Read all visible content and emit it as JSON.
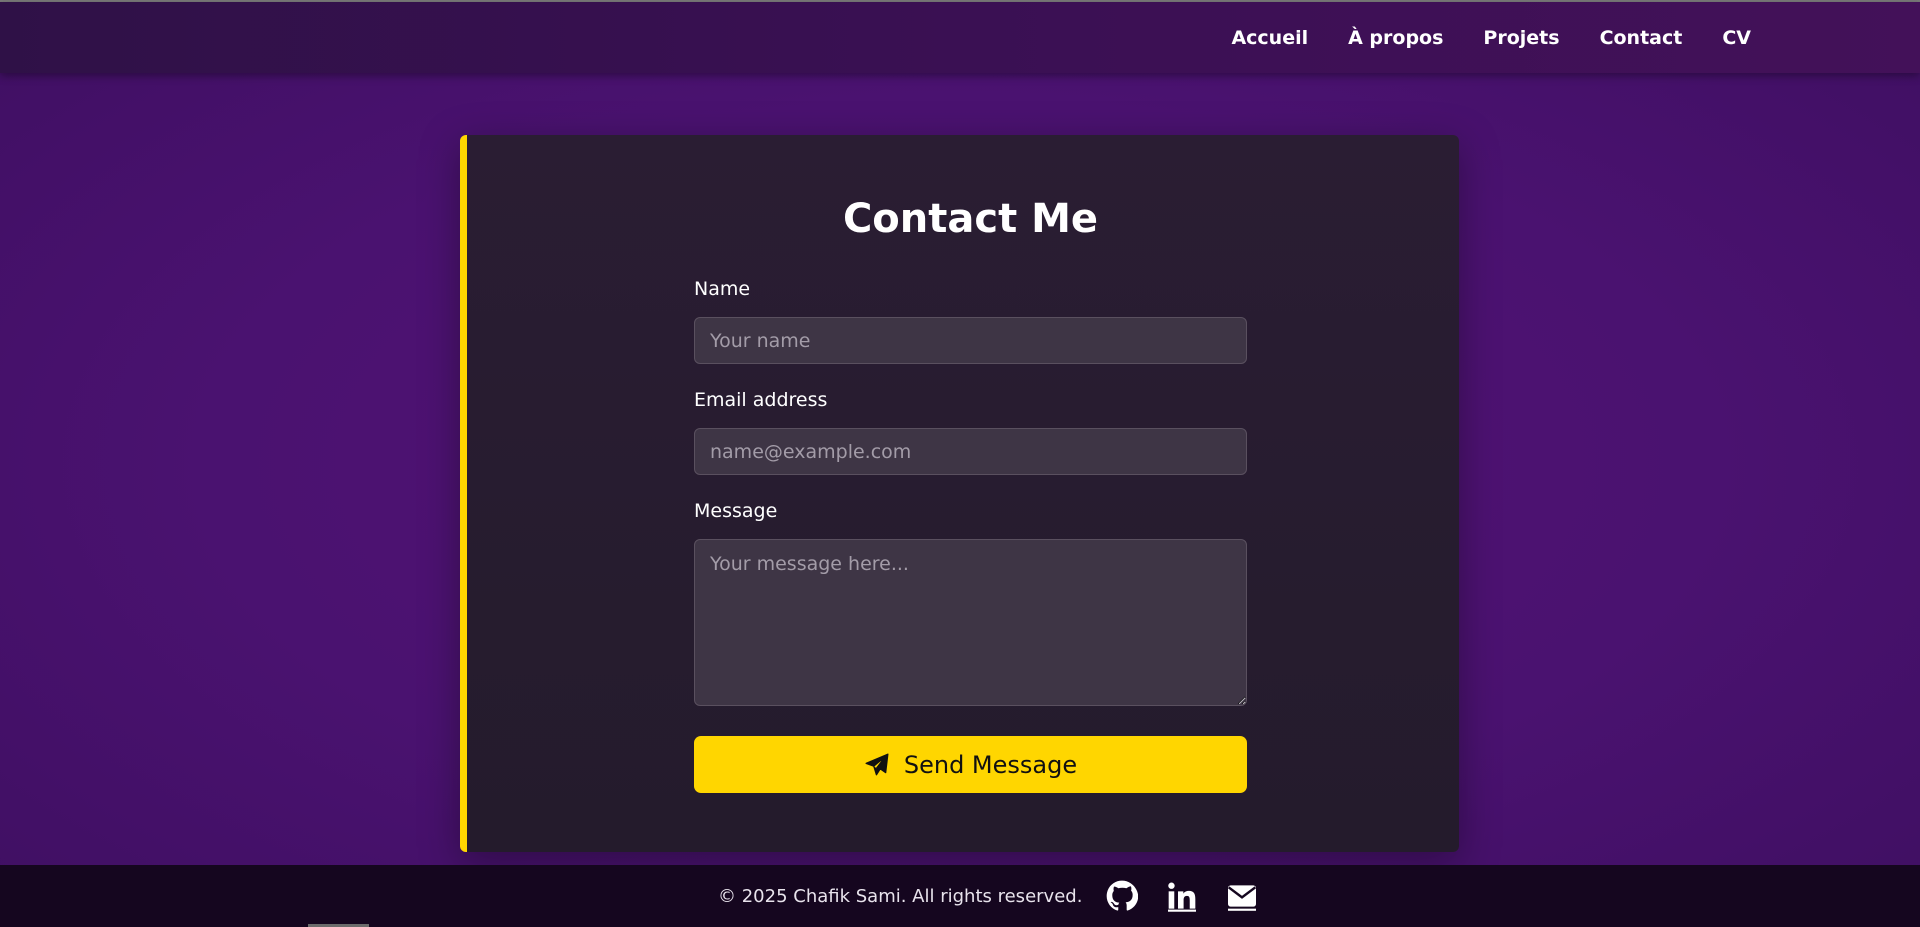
{
  "nav": {
    "links": [
      "Accueil",
      "À propos",
      "Projets",
      "Contact",
      "CV"
    ]
  },
  "contact": {
    "title": "Contact Me",
    "name_label": "Name",
    "name_placeholder": "Your name",
    "email_label": "Email address",
    "email_placeholder": "name@example.com",
    "message_label": "Message",
    "message_placeholder": "Your message here...",
    "submit_label": "Send Message",
    "submit_icon": "paper-plane-icon"
  },
  "footer": {
    "copyright": "© 2025 Chafik Sami. All rights reserved.",
    "social_icons": [
      "github-icon",
      "linkedin-icon",
      "envelope-icon"
    ]
  },
  "colors": {
    "background": "#4a1270",
    "navbar": "#3a1053",
    "card": "#261c2e",
    "accent": "#ffd600",
    "footer": "#15061f",
    "input": "#3e3545"
  }
}
